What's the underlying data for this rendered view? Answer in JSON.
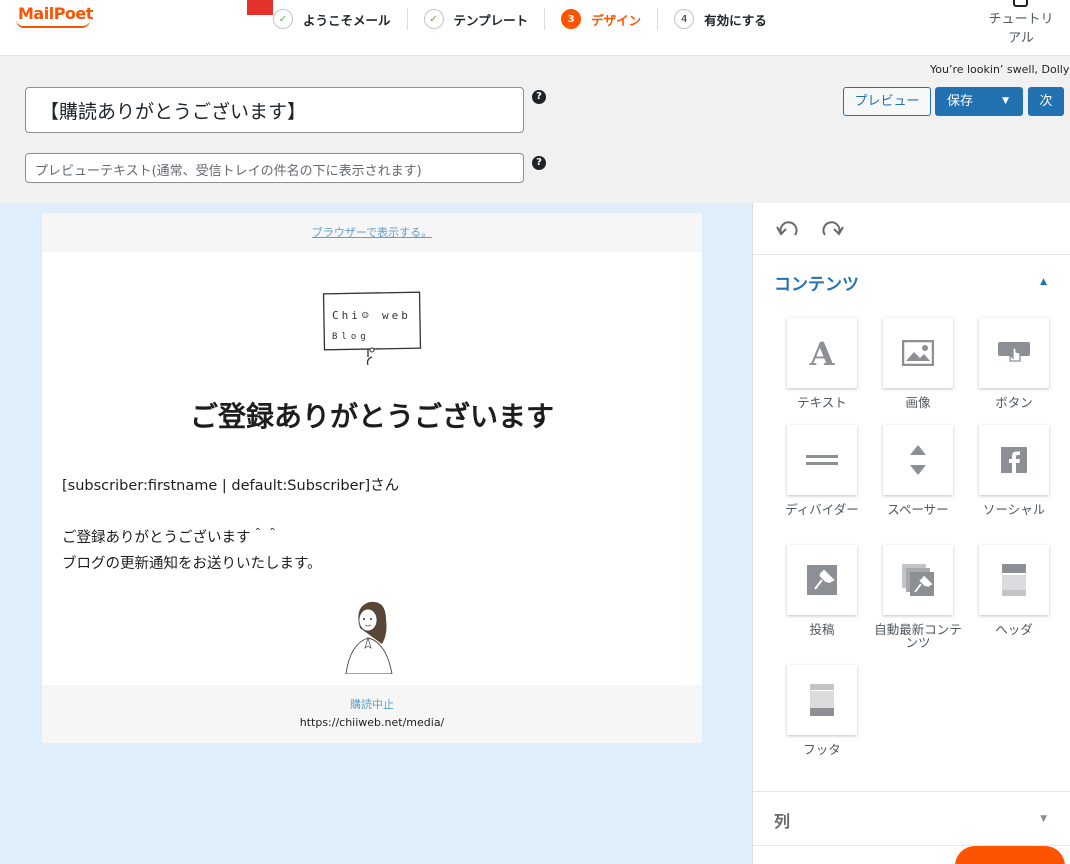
{
  "app": {
    "logo": "MailPoet"
  },
  "steps": [
    {
      "label": "ようこそメール",
      "marker": "✓"
    },
    {
      "label": "テンプレート",
      "marker": "✓"
    },
    {
      "label": "デザイン",
      "marker": "3"
    },
    {
      "label": "有効にする",
      "marker": "4"
    }
  ],
  "tutorial": {
    "line1": "チュートリ",
    "line2": "アル"
  },
  "notice": "You’re lookin’ swell, Dolly",
  "subject": {
    "value": "【購読ありがとうございます】"
  },
  "preheader": {
    "placeholder": "プレビューテキスト(通常、受信トレイの件名の下に表示されます)"
  },
  "help": "?",
  "toolbar": {
    "preview": "プレビュー",
    "save": "保存",
    "save_caret": "▼",
    "next": "次"
  },
  "email": {
    "browser_link": "ブラウザーで表示する。",
    "title": "ご登録ありがとうございます",
    "body": [
      "[subscriber:firstname | default:Subscriber]さん",
      "",
      "ご登録ありがとうございます＾＾",
      "ブログの更新通知をお送りいたします。"
    ],
    "unsubscribe": "購読中止",
    "site": "https://chiiweb.net/media/"
  },
  "sidebar": {
    "content_title": "コンテンツ",
    "content_caret": "▲",
    "blocks": [
      {
        "label": "テキスト",
        "icon": "text-icon"
      },
      {
        "label": "画像",
        "icon": "image-icon"
      },
      {
        "label": "ボタン",
        "icon": "button-icon"
      },
      {
        "label": "ディバイダー",
        "icon": "divider-icon"
      },
      {
        "label": "スペーサー",
        "icon": "spacer-icon"
      },
      {
        "label": "ソーシャル",
        "icon": "social-icon"
      },
      {
        "label": "投稿",
        "icon": "posts-icon"
      },
      {
        "label": "自動最新コンテンツ",
        "icon": "auto-latest-icon"
      },
      {
        "label": "ヘッダ",
        "icon": "header-icon"
      },
      {
        "label": "フッタ",
        "icon": "footer-icon"
      }
    ],
    "columns_title": "列",
    "columns_caret": "▼"
  },
  "colors": {
    "brand": "#fe5301",
    "primary": "#2271b1",
    "canvas": "#deeefa"
  }
}
